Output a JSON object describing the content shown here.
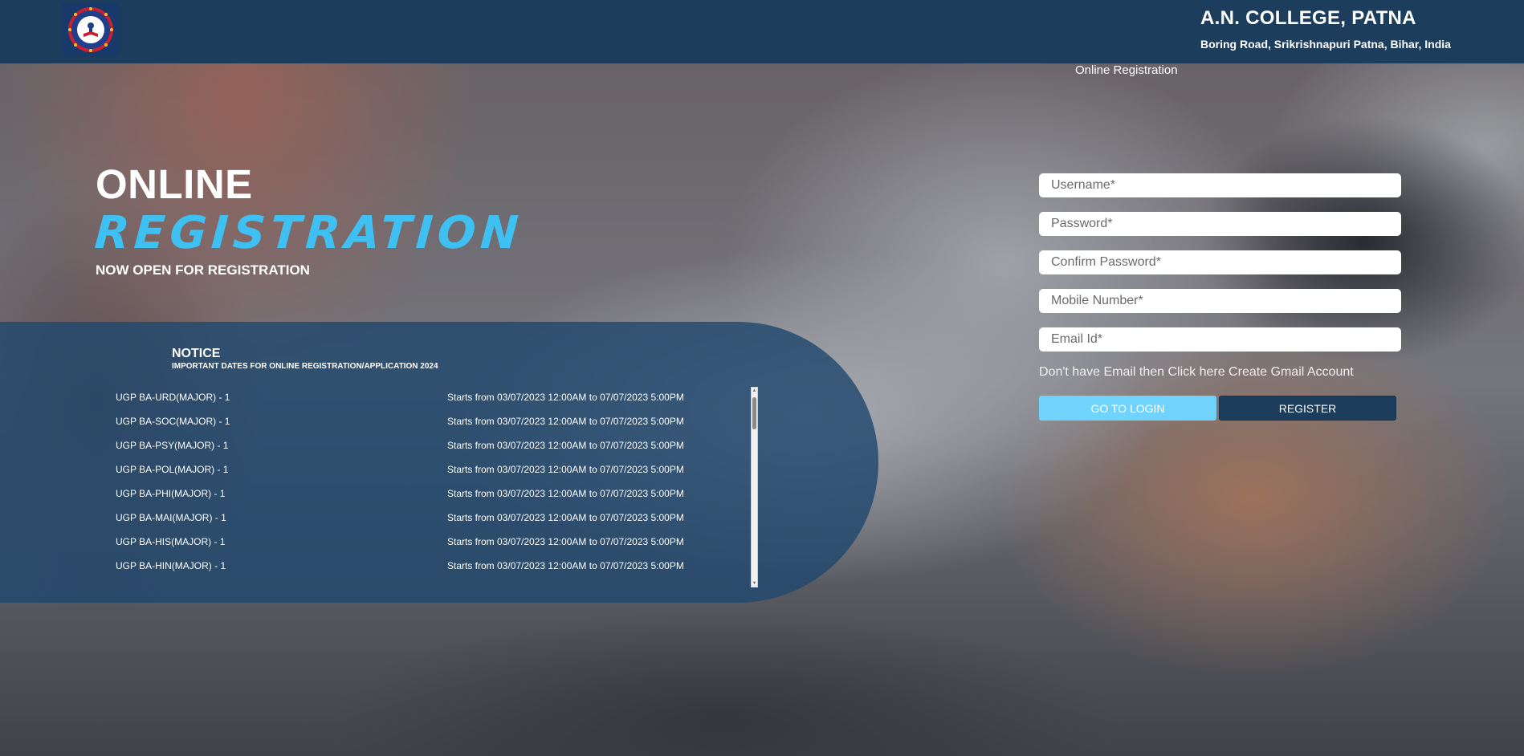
{
  "header": {
    "college_name": "A.N. COLLEGE, PATNA",
    "address": "Boring Road, Srikrishnapuri Patna, Bihar, India",
    "page_subtitle": "Online Registration"
  },
  "hero": {
    "line1": "ONLINE",
    "line2": "REGISTRATION",
    "line3": "NOW OPEN FOR REGISTRATION"
  },
  "notice": {
    "title": "NOTICE",
    "subtitle": "IMPORTANT DATES FOR ONLINE REGISTRATION/APPLICATION 2024",
    "rows": [
      {
        "course": "UGP BA-URD(MAJOR) - 1",
        "dates": "Starts from 03/07/2023 12:00AM to 07/07/2023 5:00PM"
      },
      {
        "course": "UGP BA-SOC(MAJOR) - 1",
        "dates": "Starts from 03/07/2023 12:00AM to 07/07/2023 5:00PM"
      },
      {
        "course": "UGP BA-PSY(MAJOR) - 1",
        "dates": "Starts from 03/07/2023 12:00AM to 07/07/2023 5:00PM"
      },
      {
        "course": "UGP BA-POL(MAJOR) - 1",
        "dates": "Starts from 03/07/2023 12:00AM to 07/07/2023 5:00PM"
      },
      {
        "course": "UGP BA-PHI(MAJOR) - 1",
        "dates": "Starts from 03/07/2023 12:00AM to 07/07/2023 5:00PM"
      },
      {
        "course": "UGP BA-MAI(MAJOR) - 1",
        "dates": "Starts from 03/07/2023 12:00AM to 07/07/2023 5:00PM"
      },
      {
        "course": "UGP BA-HIS(MAJOR) - 1",
        "dates": "Starts from 03/07/2023 12:00AM to 07/07/2023 5:00PM"
      },
      {
        "course": "UGP BA-HIN(MAJOR) - 1",
        "dates": "Starts from 03/07/2023 12:00AM to 07/07/2023 5:00PM"
      }
    ]
  },
  "form": {
    "username_placeholder": "Username*",
    "password_placeholder": "Password*",
    "confirm_password_placeholder": "Confirm Password*",
    "mobile_placeholder": "Mobile Number*",
    "email_placeholder": "Email Id*",
    "gmail_link": "Don't have Email then Click here Create Gmail Account",
    "login_label": "GO TO LOGIN",
    "register_label": "REGISTER"
  },
  "colors": {
    "header_bg": "#1d3d5c",
    "accent": "#3ec0f2",
    "login_button": "#6fd3fb",
    "register_button": "#1d3d5c"
  },
  "icons": {
    "logo": "college-emblem"
  }
}
